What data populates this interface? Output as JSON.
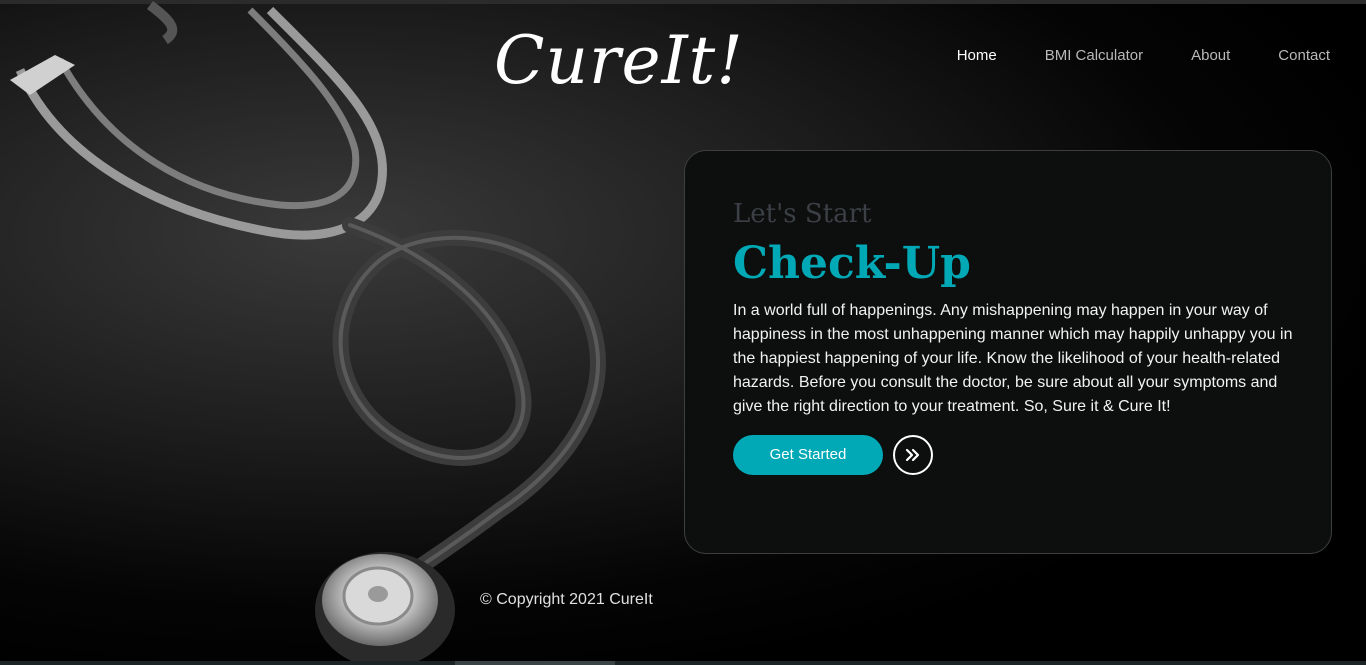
{
  "brand": {
    "logo_text": "CureIt!"
  },
  "nav": {
    "items": [
      {
        "label": "Home",
        "active": true
      },
      {
        "label": "BMI Calculator",
        "active": false
      },
      {
        "label": "About",
        "active": false
      },
      {
        "label": "Contact",
        "active": false
      }
    ]
  },
  "hero": {
    "pretitle": "Let's Start",
    "title": "Check-Up",
    "description": "In a world full of happenings. Any mishappening may happen in your way of happiness in the most unhappening manner which may happily unhappy you in the happiest happening of your life. Know the likelihood of your health-related hazards. Before you consult the doctor, be sure about all your symptoms and give the right direction to your treatment. So, Sure it & Cure It!",
    "cta_label": "Get Started",
    "next_icon": "double-chevron-right-icon"
  },
  "footer": {
    "copyright": "© Copyright 2021 CureIt"
  },
  "colors": {
    "accent": "#00a9b5",
    "card_bg": "#0d0f0f",
    "background": "#000000"
  }
}
